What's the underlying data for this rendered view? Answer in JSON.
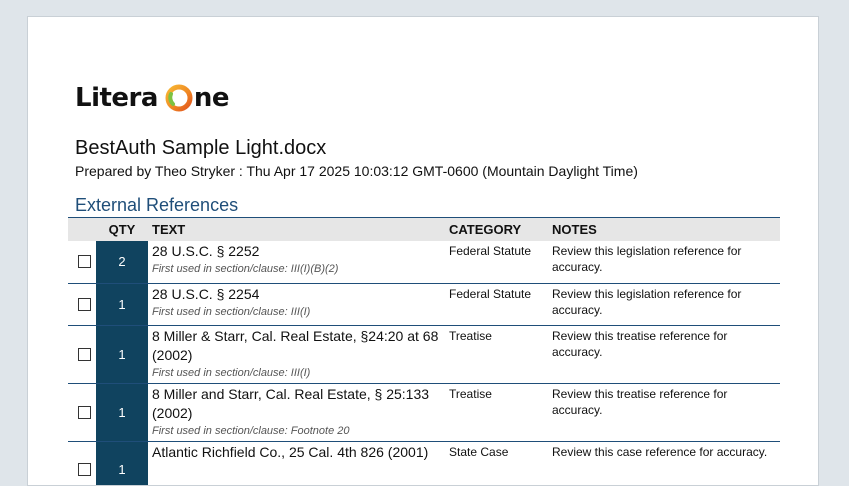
{
  "logo": {
    "text_before": "Litera ",
    "text_after": "ne"
  },
  "document": {
    "title": "BestAuth Sample Light.docx",
    "prepared": "Prepared by Theo Stryker : Thu Apr 17 2025 10:03:12 GMT-0600 (Mountain Daylight Time)"
  },
  "section": {
    "heading": "External References"
  },
  "table": {
    "headers": {
      "qty": "QTY",
      "text": "TEXT",
      "category": "CATEGORY",
      "notes": "NOTES"
    },
    "rows": [
      {
        "checked": false,
        "qty": "2",
        "text": "28 U.S.C. § 2252",
        "first_used": "First used in section/clause: III(I)(B)(2)",
        "category": "Federal Statute",
        "notes": "Review this legislation reference for accuracy."
      },
      {
        "checked": false,
        "qty": "1",
        "text": "28 U.S.C. § 2254",
        "first_used": "First used in section/clause: III(I)",
        "category": "Federal Statute",
        "notes": "Review this legislation reference for accuracy."
      },
      {
        "checked": false,
        "qty": "1",
        "text": "8 Miller & Starr, Cal. Real Estate, §24:20 at 68 (2002)",
        "first_used": "First used in section/clause: III(I)",
        "category": "Treatise",
        "notes": "Review this treatise reference for accuracy."
      },
      {
        "checked": false,
        "qty": "1",
        "text": "8 Miller and Starr, Cal. Real Estate, § 25:133 (2002)",
        "first_used": "First used in section/clause: Footnote 20",
        "category": "Treatise",
        "notes": "Review this treatise reference for accuracy."
      },
      {
        "checked": false,
        "qty": "1",
        "text": "Atlantic Richfield Co., 25 Cal. 4th 826 (2001)",
        "first_used": "",
        "category": "State Case",
        "notes": "Review this case reference for accuracy."
      }
    ]
  },
  "colors": {
    "accent": "#1f4e79",
    "qty_bg": "#10435f",
    "header_bg": "#e6e6e6",
    "logo_orange": "#f5a623",
    "logo_green": "#7dc242"
  }
}
